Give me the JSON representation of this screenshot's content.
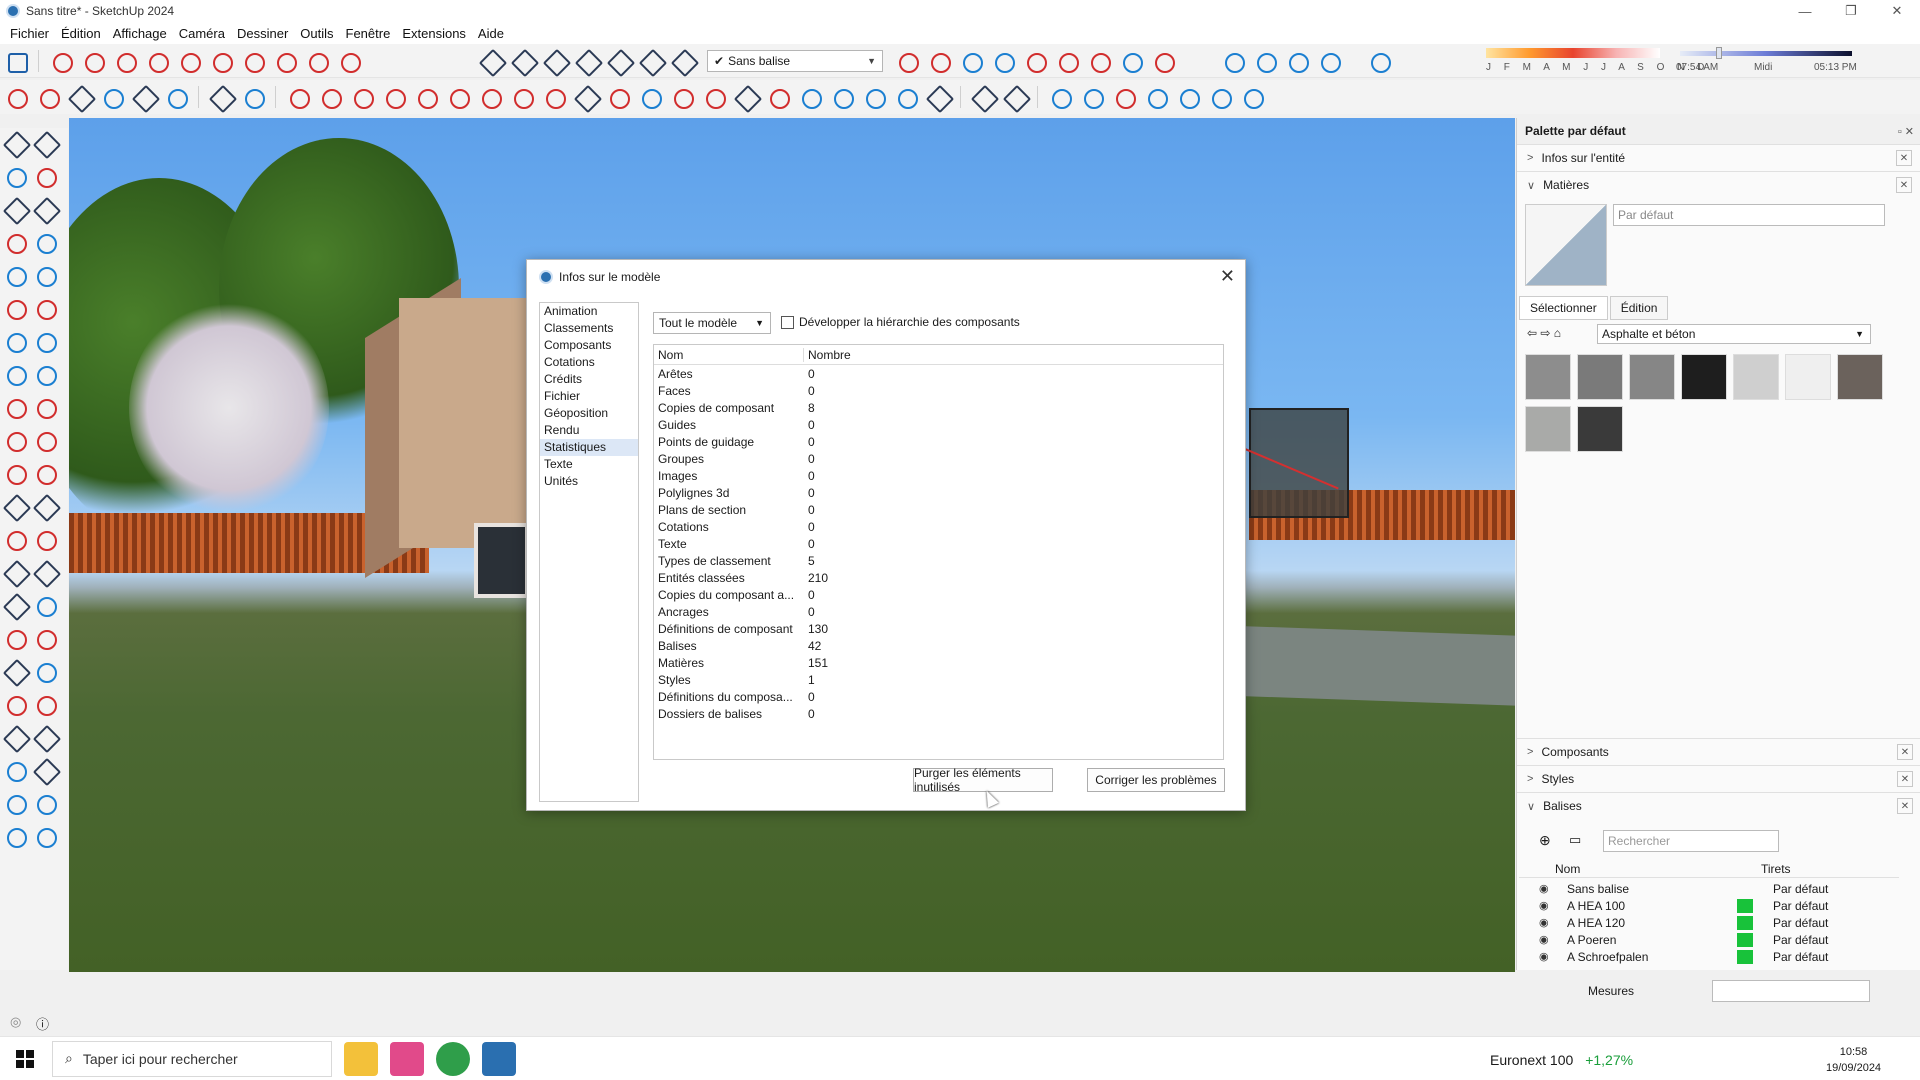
{
  "window": {
    "title": "Sans titre* - SketchUp 2024",
    "controls": [
      "—",
      "❐",
      "✕"
    ]
  },
  "menu": [
    "Fichier",
    "Édition",
    "Affichage",
    "Caméra",
    "Dessiner",
    "Outils",
    "Fenêtre",
    "Extensions",
    "Aide"
  ],
  "toolbar": {
    "tag_select": "Sans balise",
    "months": "J F M A M J J A S O N D",
    "time_start": "07:54 AM",
    "time_mid": "Midi",
    "time_end": "05:13 PM"
  },
  "dialog": {
    "title": "Infos sur le modèle",
    "nav": [
      "Animation",
      "Classements",
      "Composants",
      "Cotations",
      "Crédits",
      "Fichier",
      "Géoposition",
      "Rendu",
      "Statistiques",
      "Texte",
      "Unités"
    ],
    "nav_selected": "Statistiques",
    "scope": "Tout le modèle",
    "expand_label": "Développer la hiérarchie des composants",
    "col_name": "Nom",
    "col_count": "Nombre",
    "rows": [
      {
        "name": "Arêtes",
        "count": "0"
      },
      {
        "name": "Faces",
        "count": "0"
      },
      {
        "name": "Copies de composant",
        "count": "8"
      },
      {
        "name": "Guides",
        "count": "0"
      },
      {
        "name": "Points de guidage",
        "count": "0"
      },
      {
        "name": "Groupes",
        "count": "0"
      },
      {
        "name": "Images",
        "count": "0"
      },
      {
        "name": "Polylignes 3d",
        "count": "0"
      },
      {
        "name": "Plans de section",
        "count": "0"
      },
      {
        "name": "Cotations",
        "count": "0"
      },
      {
        "name": "Texte",
        "count": "0"
      },
      {
        "name": "Types de classement",
        "count": "5"
      },
      {
        "name": "Entités classées",
        "count": "210"
      },
      {
        "name": "Copies du composant a...",
        "count": "0"
      },
      {
        "name": "Ancrages",
        "count": "0"
      },
      {
        "name": "Définitions de composant",
        "count": "130"
      },
      {
        "name": "Balises",
        "count": "42"
      },
      {
        "name": "Matières",
        "count": "151"
      },
      {
        "name": "Styles",
        "count": "1"
      },
      {
        "name": "Définitions du composa...",
        "count": "0"
      },
      {
        "name": "Dossiers de balises",
        "count": "0"
      }
    ],
    "purge_label": "Purger les éléments inutilisés",
    "fix_label": "Corriger les problèmes"
  },
  "tray": {
    "title": "Palette par défaut",
    "entity_info": "Infos sur l'entité",
    "materials": "Matières",
    "material_name": "Par défaut",
    "tab_select": "Sélectionner",
    "tab_edit": "Édition",
    "library": "Asphalte et béton",
    "swatches": [
      "#8d8d8d",
      "#7a7a7a",
      "#868686",
      "#1e1e1e",
      "#cfcfcf",
      "#efefef",
      "#6b625c",
      "#a9aaa8",
      "#3a3a3a"
    ],
    "components": "Composants",
    "styles": "Styles",
    "tags": "Balises",
    "tag_search": "Rechercher",
    "tag_col_name": "Nom",
    "tag_col_dash": "Tirets",
    "tags_list": [
      {
        "name": "Sans balise",
        "dash": "Par défaut",
        "color": ""
      },
      {
        "name": "A HEA 100",
        "dash": "Par défaut",
        "color": "#18c23a"
      },
      {
        "name": "A HEA 120",
        "dash": "Par défaut",
        "color": "#18c23a"
      },
      {
        "name": "A Poeren",
        "dash": "Par défaut",
        "color": "#18c23a"
      },
      {
        "name": "A Schroefpalen",
        "dash": "Par défaut",
        "color": "#18c23a"
      }
    ]
  },
  "measures": "Mesures",
  "taskbar": {
    "search": "Taper ici pour rechercher",
    "stock_name": "Euronext 100",
    "stock_change": "+1,27%",
    "time": "10:58",
    "date": "19/09/2024"
  }
}
